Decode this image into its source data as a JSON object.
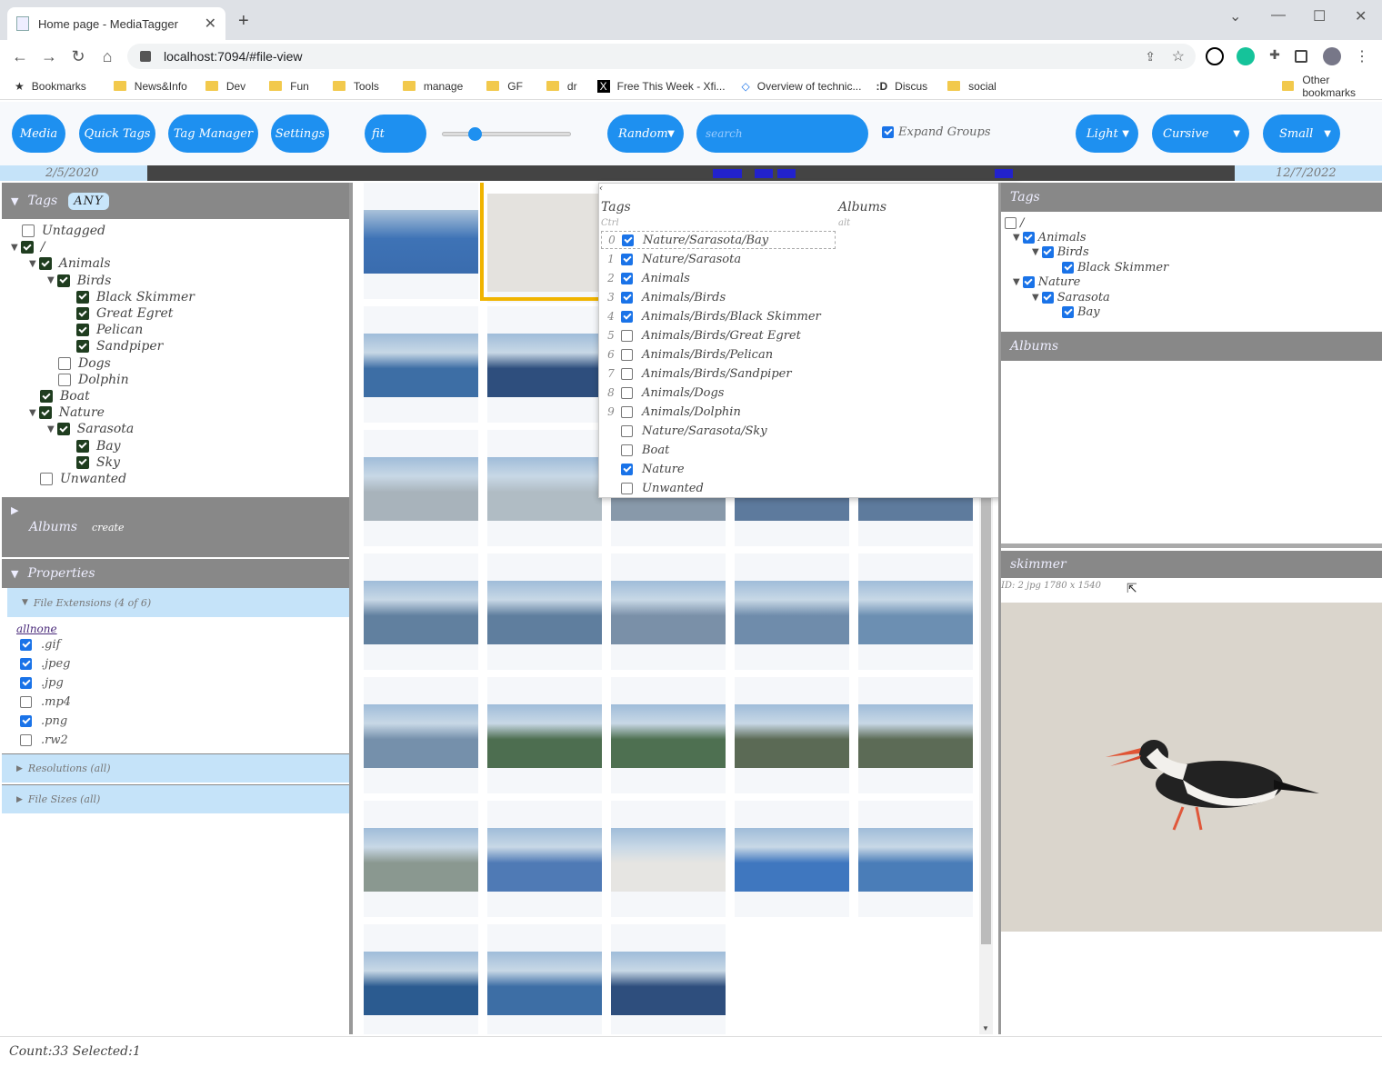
{
  "browser": {
    "tab_title": "Home page - MediaTagger",
    "url": "localhost:7094/#file-view",
    "bookmarks": [
      "Bookmarks",
      "News&Info",
      "Dev",
      "Fun",
      "Tools",
      "manage",
      "GF",
      "dr",
      "Free This Week - Xfi...",
      "Overview of technic...",
      "Discus",
      "social"
    ],
    "other_bookmarks": "Other bookmarks"
  },
  "toolbar": {
    "media": "Media",
    "quick_tags": "Quick Tags",
    "tag_manager": "Tag Manager",
    "settings": "Settings",
    "fit": "fit",
    "random": "Random",
    "search_placeholder": "search",
    "expand_groups": "Expand Groups",
    "theme": "Light",
    "font": "Cursive",
    "size": "Small"
  },
  "timeline": {
    "start": "2/5/2020",
    "end": "12/7/2022"
  },
  "left": {
    "tags_title": "Tags",
    "any": "ANY",
    "albums_title": "Albums",
    "albums_create": "create",
    "properties_title": "Properties",
    "file_ext": "File Extensions (4 of 6)",
    "allnone": "allnone",
    "exts": [
      {
        "n": ".gif",
        "c": true
      },
      {
        "n": ".jpeg",
        "c": true
      },
      {
        "n": ".jpg",
        "c": true
      },
      {
        "n": ".mp4",
        "c": false
      },
      {
        "n": ".png",
        "c": true
      },
      {
        "n": ".rw2",
        "c": false
      }
    ],
    "resolutions": "Resolutions (all)",
    "file_sizes": "File Sizes (all)",
    "tree": [
      {
        "n": "Untagged",
        "c": false,
        "d": 0
      },
      {
        "n": "/",
        "c": true,
        "d": 0
      },
      {
        "n": "Animals",
        "c": true,
        "d": 1
      },
      {
        "n": "Birds",
        "c": true,
        "d": 2
      },
      {
        "n": "Black Skimmer",
        "c": true,
        "d": 3
      },
      {
        "n": "Great Egret",
        "c": true,
        "d": 3
      },
      {
        "n": "Pelican",
        "c": true,
        "d": 3
      },
      {
        "n": "Sandpiper",
        "c": true,
        "d": 3
      },
      {
        "n": "Dogs",
        "c": false,
        "d": 2
      },
      {
        "n": "Dolphin",
        "c": false,
        "d": 2
      },
      {
        "n": "Boat",
        "c": true,
        "d": 1
      },
      {
        "n": "Nature",
        "c": true,
        "d": 1
      },
      {
        "n": "Sarasota",
        "c": true,
        "d": 2
      },
      {
        "n": "Bay",
        "c": true,
        "d": 3
      },
      {
        "n": "Sky",
        "c": true,
        "d": 3
      },
      {
        "n": "Unwanted",
        "c": false,
        "d": 1
      }
    ]
  },
  "popup": {
    "tags": "Tags",
    "albums": "Albums",
    "ctrl": "Ctrl",
    "alt": "alt",
    "rows": [
      {
        "k": "0",
        "n": "Nature/Sarasota/Bay",
        "c": true
      },
      {
        "k": "1",
        "n": "Nature/Sarasota",
        "c": true
      },
      {
        "k": "2",
        "n": "Animals",
        "c": true
      },
      {
        "k": "3",
        "n": "Animals/Birds",
        "c": true
      },
      {
        "k": "4",
        "n": "Animals/Birds/Black Skimmer",
        "c": true
      },
      {
        "k": "5",
        "n": "Animals/Birds/Great Egret",
        "c": false
      },
      {
        "k": "6",
        "n": "Animals/Birds/Pelican",
        "c": false
      },
      {
        "k": "7",
        "n": "Animals/Birds/Sandpiper",
        "c": false
      },
      {
        "k": "8",
        "n": "Animals/Dogs",
        "c": false
      },
      {
        "k": "9",
        "n": "Animals/Dolphin",
        "c": false
      },
      {
        "k": "",
        "n": "Nature/Sarasota/Sky",
        "c": false
      },
      {
        "k": "",
        "n": "Boat",
        "c": false
      },
      {
        "k": "",
        "n": "Nature",
        "c": true
      },
      {
        "k": "",
        "n": "Unwanted",
        "c": false
      }
    ]
  },
  "right": {
    "tags_title": "Tags",
    "albums_title": "Albums",
    "preview_title": "skimmer",
    "meta": "ID: 2 jpg 1780 x 1540",
    "tree": [
      {
        "n": "/",
        "c": false,
        "d": 0
      },
      {
        "n": "Animals",
        "c": true,
        "d": 1
      },
      {
        "n": "Birds",
        "c": true,
        "d": 2
      },
      {
        "n": "Black Skimmer",
        "c": true,
        "d": 3
      },
      {
        "n": "Nature",
        "c": true,
        "d": 1
      },
      {
        "n": "Sarasota",
        "c": true,
        "d": 2
      },
      {
        "n": "Bay",
        "c": true,
        "d": 3
      }
    ]
  },
  "thumbs": [
    "#4f7ab5",
    "#e6e5e2",
    "#3f77bf",
    "#4a7db8",
    "#2b5b90",
    "#3d6ea5",
    "#2e4e7d",
    "#e8eef6",
    "#8ea7be",
    "#b9c4cc",
    "#a8b3bb",
    "#b0bcc4",
    "#8899aa",
    "#5d7a9d",
    "#5e7b9d",
    "#61809f",
    "#5f7e9e",
    "#7a90a8",
    "#6f8cab",
    "#6c8fb2",
    "#7590ab",
    "#4d6e50",
    "#4e7051",
    "#5b6a55",
    "#5c6b56",
    "#8a9890"
  ],
  "status": "Count:33 Selected:1",
  "colors": {
    "accent": "#1e90f0",
    "panel": "#888888",
    "highlight": "#f0b400"
  }
}
